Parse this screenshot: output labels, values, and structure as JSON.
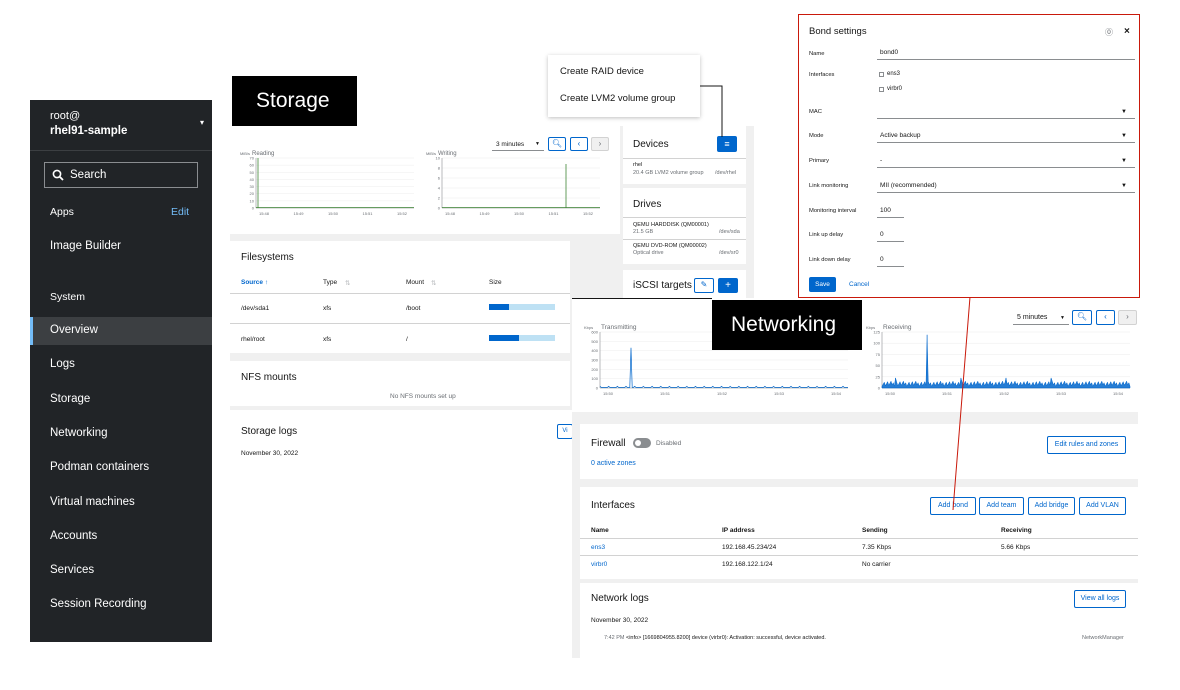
{
  "sidebar": {
    "user": "root@",
    "host": "rhel91-sample",
    "search_label": "Search",
    "apps_label": "Apps",
    "edit_label": "Edit",
    "image_builder": "Image Builder",
    "system_label": "System",
    "items": [
      "Overview",
      "Logs",
      "Storage",
      "Networking",
      "Podman containers",
      "Virtual machines",
      "Accounts",
      "Services",
      "Session Recording"
    ]
  },
  "storage": {
    "title": "Storage",
    "time_select": "3 minutes",
    "reading": {
      "unit": "MiB/s",
      "label": "Reading",
      "yticks": [
        "70",
        "60",
        "50",
        "40",
        "30",
        "20",
        "10",
        "0"
      ],
      "xticks": [
        "15:48",
        "15:49",
        "15:50",
        "15:51",
        "15:52"
      ]
    },
    "writing": {
      "unit": "MiB/s",
      "label": "Writing",
      "yticks": [
        "10",
        "8",
        "6",
        "4",
        "2",
        "0"
      ],
      "xticks": [
        "15:48",
        "15:49",
        "15:50",
        "15:51",
        "15:52"
      ]
    },
    "filesystems": {
      "title": "Filesystems",
      "columns": [
        "Source",
        "Type",
        "Mount",
        "Size"
      ],
      "rows": [
        {
          "source": "/dev/sda1",
          "type": "xfs",
          "mount": "/boot",
          "used": 0.3
        },
        {
          "source": "rhel/root",
          "type": "xfs",
          "mount": "/",
          "used": 0.45
        }
      ]
    },
    "nfs": {
      "title": "NFS mounts",
      "empty": "No NFS mounts set up"
    },
    "logs": {
      "title": "Storage logs",
      "date": "November 30, 2022",
      "btn": "Vi"
    },
    "menu": [
      "Create RAID device",
      "Create LVM2 volume group"
    ],
    "devices": {
      "title": "Devices",
      "item_name": "rhel",
      "item_desc": "20.4 GB LVM2 volume group",
      "item_path": "/dev/rhel"
    },
    "drives": {
      "title": "Drives",
      "items": [
        {
          "name": "QEMU HARDDISK (QM00001)",
          "size": "21.5 GB",
          "path": "/dev/sda"
        },
        {
          "name": "QEMU DVD-ROM (QM00002)",
          "size": "Optical drive",
          "path": "/dev/sr0"
        }
      ]
    },
    "iscsi": {
      "title": "iSCSI targets"
    }
  },
  "networking": {
    "title": "Networking",
    "time_select": "5 minutes",
    "transmitting": {
      "unit": "Kbps",
      "label": "Transmitting",
      "yticks": [
        "600",
        "500",
        "400",
        "300",
        "200",
        "100",
        "0"
      ],
      "xticks": [
        "15:50",
        "15:51",
        "15:52",
        "15:53",
        "15:54"
      ]
    },
    "receiving": {
      "unit": "Kbps",
      "label": "Receiving",
      "yticks": [
        "125",
        "100",
        "75",
        "50",
        "25",
        "0"
      ],
      "xticks": [
        "15:50",
        "15:51",
        "15:52",
        "15:53",
        "15:54"
      ]
    },
    "firewall": {
      "label": "Firewall",
      "status": "Disabled",
      "zones": "0 active zones",
      "edit_btn": "Edit rules and zones"
    },
    "interfaces": {
      "title": "Interfaces",
      "buttons": [
        "Add bond",
        "Add team",
        "Add bridge",
        "Add VLAN"
      ],
      "columns": [
        "Name",
        "IP address",
        "Sending",
        "Receiving"
      ],
      "rows": [
        {
          "name": "ens3",
          "ip": "192.168.45.234/24",
          "sending": "7.35 Kbps",
          "receiving": "5.66 Kbps"
        },
        {
          "name": "virbr0",
          "ip": "192.168.122.1/24",
          "sending": "No carrier",
          "receiving": ""
        }
      ]
    },
    "logs": {
      "title": "Network logs",
      "btn": "View all logs",
      "date": "November 30, 2022",
      "entry_time": "7:42 PM",
      "entry_text": "<info> [1669804955.8200] device (virbr0): Activation: successful, device activated.",
      "entry_src": "NetworkManager"
    }
  },
  "bond": {
    "title": "Bond settings",
    "fields": {
      "name_label": "Name",
      "name_value": "bond0",
      "interfaces_label": "Interfaces",
      "iface1": "ens3",
      "iface2": "virbr0",
      "mac_label": "MAC",
      "mac_value": "",
      "mode_label": "Mode",
      "mode_value": "Active backup",
      "primary_label": "Primary",
      "primary_value": "-",
      "link_mon_label": "Link monitoring",
      "link_mon_value": "MII (recommended)",
      "mon_int_label": "Monitoring interval",
      "mon_int_value": "100",
      "up_delay_label": "Link up delay",
      "up_delay_value": "0",
      "down_delay_label": "Link down delay",
      "down_delay_value": "0"
    },
    "save": "Save",
    "cancel": "Cancel"
  },
  "colors": {
    "accent": "#0066cc",
    "sidebar_bg": "#212427",
    "callout": "#c9190b",
    "label_bg": "#000000"
  }
}
